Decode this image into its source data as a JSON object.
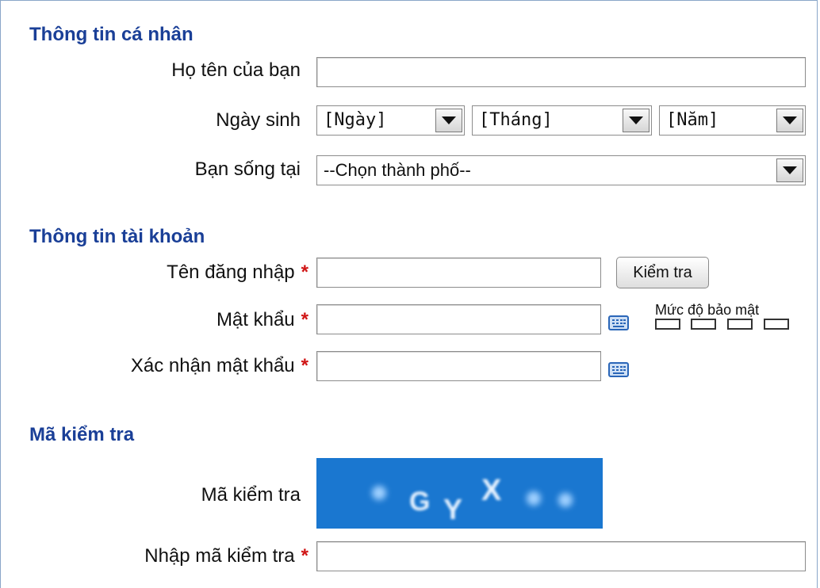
{
  "sections": {
    "personal": "Thông tin cá nhân",
    "account": "Thông tin tài khoản",
    "captcha": "Mã kiểm tra"
  },
  "personal": {
    "fullname_label": "Họ tên của bạn",
    "fullname_value": "",
    "dob_label": "Ngày sinh",
    "day_selected": "[Ngày]",
    "month_selected": "[Tháng]",
    "year_selected": "[Năm]",
    "city_label": "Bạn sống tại",
    "city_selected": "--Chọn thành phố--"
  },
  "account": {
    "username_label": "Tên đăng nhập",
    "username_value": "",
    "check_button": "Kiểm tra",
    "password_label": "Mật khẩu",
    "password_value": "",
    "confirm_label": "Xác nhận mật khẩu",
    "confirm_value": "",
    "strength_label": "Mức độ bảo mật",
    "required_mark": "*"
  },
  "captcha": {
    "image_label": "Mã kiểm tra",
    "captcha_text": "GYX",
    "input_label": "Nhập mã kiểm tra",
    "input_value": ""
  },
  "colors": {
    "section_title": "#1a3f97",
    "required": "#d01515",
    "captcha_bg": "#1a77d0",
    "keyboard_icon": "#2a66b8"
  },
  "icons": [
    "keyboard-icon",
    "dropdown-arrow-icon"
  ]
}
